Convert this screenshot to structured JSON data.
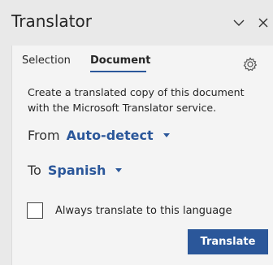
{
  "header": {
    "title": "Translator",
    "collapse_icon": "chevron-down-icon",
    "close_icon": "close-icon"
  },
  "tabs": [
    {
      "label": "Selection",
      "selected": false
    },
    {
      "label": "Document",
      "selected": true
    }
  ],
  "settings_icon": "gear-icon",
  "description": "Create a translated copy of this document with the Microsoft Translator service.",
  "from": {
    "label": "From",
    "value": "Auto-detect"
  },
  "to": {
    "label": "To",
    "value": "Spanish"
  },
  "always_translate": {
    "label": "Always translate to this language",
    "checked": false
  },
  "translate_button": "Translate",
  "colors": {
    "accent": "#2b579a",
    "background": "#e9e9e9",
    "panel": "#f4f4f4"
  }
}
